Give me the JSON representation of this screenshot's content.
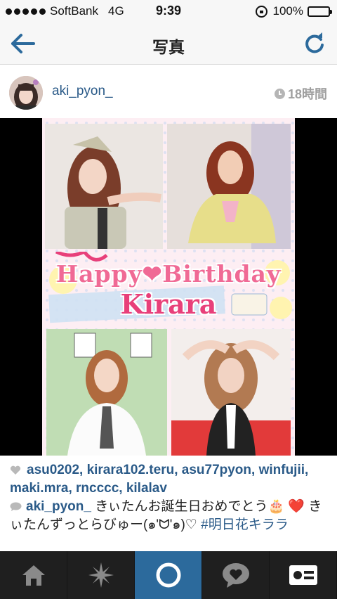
{
  "status_bar": {
    "carrier": "SoftBank",
    "network": "4G",
    "time": "9:39",
    "battery": "100%"
  },
  "nav": {
    "title": "写真",
    "back_icon": "back-arrow-icon",
    "refresh_icon": "refresh-icon"
  },
  "post": {
    "username": "aki_pyon_",
    "time_ago": "18時間",
    "image_text": {
      "line1": "Happy❤Birthday",
      "line2": "Kirara"
    },
    "likes": "asu0202, kirara102.teru, asu77pyon, winfujii, maki.mra, rncccc, kilalav",
    "caption_user": "aki_pyon_",
    "caption_text": " きぃたんお誕生日おめでとう🎂 ❤️ きぃたんずっとらびゅー(๑'ᗢ'๑)♡ ",
    "caption_tag": "#明日花キララ"
  },
  "tabbar": {
    "items": [
      "home-icon",
      "explore-icon",
      "camera-icon",
      "activity-icon",
      "profile-icon"
    ],
    "active": 2
  },
  "colors": {
    "accent": "#2a5a88",
    "tab_active": "#2c6a9c",
    "tab_bg": "#1f1f1f"
  }
}
